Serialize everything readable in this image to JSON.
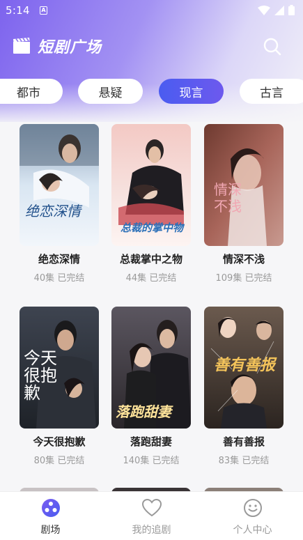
{
  "status": {
    "time": "5:14",
    "notif_glyph": "A"
  },
  "header": {
    "title": "短剧广场"
  },
  "tabs": [
    {
      "label": "都市",
      "active": false
    },
    {
      "label": "悬疑",
      "active": false
    },
    {
      "label": "现言",
      "active": true
    },
    {
      "label": "古言",
      "active": false
    }
  ],
  "dramas": [
    {
      "title": "绝恋深情",
      "episodes": "40集",
      "status": "已完结",
      "poster_text": "绝恋深情"
    },
    {
      "title": "总裁掌中之物",
      "episodes": "44集",
      "status": "已完结",
      "poster_text": "总裁的掌中物"
    },
    {
      "title": "情深不浅",
      "episodes": "109集",
      "status": "已完结",
      "poster_text": "情深不浅"
    },
    {
      "title": "今天很抱歉",
      "episodes": "80集",
      "status": "已完结",
      "poster_text": "今天很抱歉"
    },
    {
      "title": "落跑甜妻",
      "episodes": "140集",
      "status": "已完结",
      "poster_text": "落跑甜妻"
    },
    {
      "title": "善有善报",
      "episodes": "83集",
      "status": "已完结",
      "poster_text": "善有善报"
    }
  ],
  "nav": [
    {
      "label": "剧场",
      "icon": "theater-icon",
      "active": true
    },
    {
      "label": "我的追剧",
      "icon": "heart-icon",
      "active": false
    },
    {
      "label": "个人中心",
      "icon": "smiley-icon",
      "active": false
    }
  ],
  "colors": {
    "accent": "#5b5cf0",
    "header_start": "#7d63ee",
    "tab_active_start": "#4a5cf0"
  }
}
